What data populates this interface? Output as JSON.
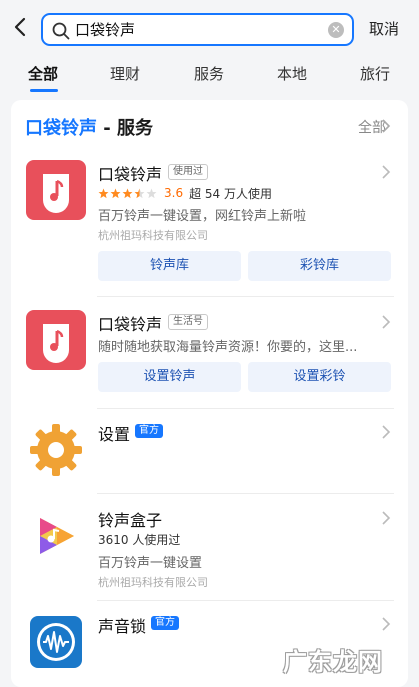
{
  "header": {
    "query": "口袋铃声",
    "cancel_label": "取消"
  },
  "tabs": [
    {
      "label": "全部",
      "active": true
    },
    {
      "label": "理财",
      "active": false
    },
    {
      "label": "服务",
      "active": false
    },
    {
      "label": "本地",
      "active": false
    },
    {
      "label": "旅行",
      "active": false
    }
  ],
  "section": {
    "title_highlight": "口袋铃声",
    "title_rest": " - 服务",
    "all_label": "全部"
  },
  "results": [
    {
      "name": "口袋铃声",
      "tag": "使用过",
      "rating": 3.5,
      "score": "3.6",
      "users": "超 54 万人使用",
      "desc": "百万铃声一键设置，网红铃声上新啦",
      "company": "杭州祖玛科技有限公司",
      "buttons": [
        "铃声库",
        "彩铃库"
      ]
    },
    {
      "name": "口袋铃声",
      "tag": "生活号",
      "desc": "随时随地获取海量铃声资源！你要的，这里...",
      "buttons": [
        "设置铃声",
        "设置彩铃"
      ]
    },
    {
      "name": "设置",
      "tag": "官方"
    },
    {
      "name": "铃声盒子",
      "users": "3610 人使用过",
      "desc": "百万铃声一键设置",
      "company": "杭州祖玛科技有限公司"
    },
    {
      "name": "声音锁",
      "tag": "官方"
    }
  ],
  "icons": {
    "back": "chevron-left-icon",
    "search": "search-icon",
    "clear": "clear-icon",
    "more": "chevron-right-icon"
  },
  "colors": {
    "accent": "#1677ff",
    "rating": "#ff6a00",
    "app_red": "#e8505b",
    "gear_orange": "#f0a234"
  },
  "watermark": "广东龙网"
}
